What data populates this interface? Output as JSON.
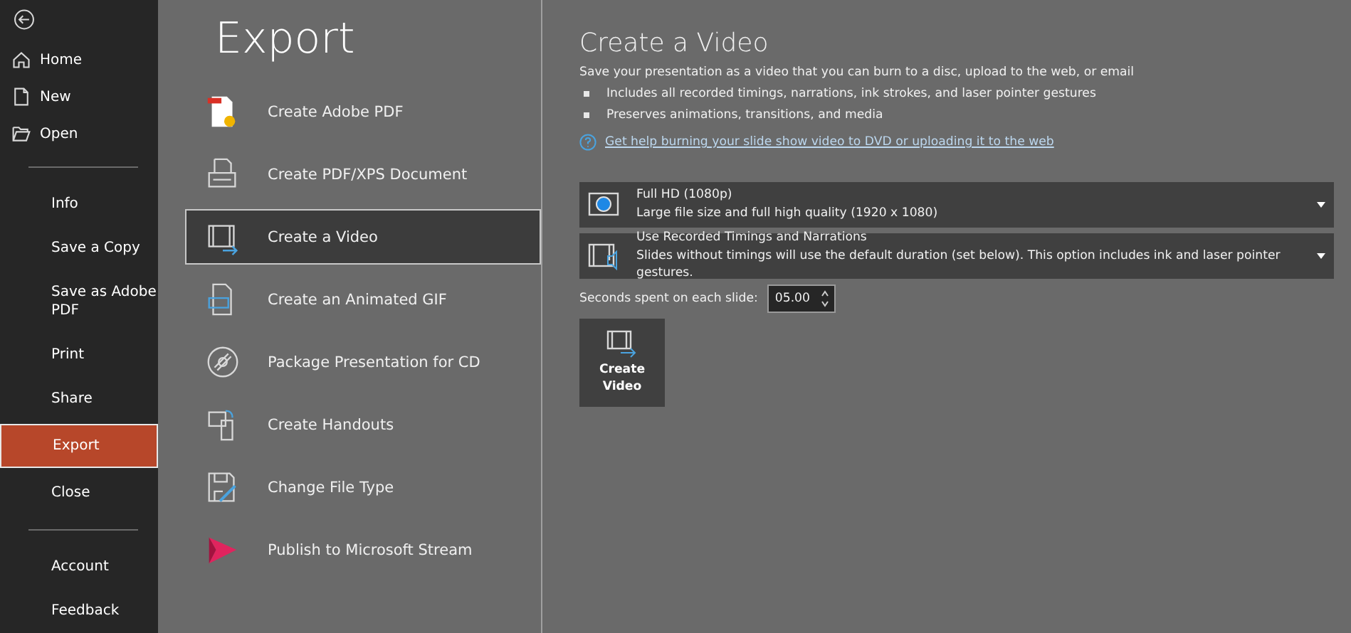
{
  "sidebar": {
    "top": [
      {
        "label": "Home"
      },
      {
        "label": "New"
      },
      {
        "label": "Open"
      }
    ],
    "middle": [
      {
        "label": "Info",
        "selected": false
      },
      {
        "label": "Save a Copy",
        "selected": false
      },
      {
        "label": "Save as Adobe PDF",
        "selected": false
      },
      {
        "label": "Print",
        "selected": false
      },
      {
        "label": "Share",
        "selected": false
      },
      {
        "label": "Export",
        "selected": true
      },
      {
        "label": "Close",
        "selected": false
      }
    ],
    "bottom": [
      {
        "label": "Account"
      },
      {
        "label": "Feedback"
      }
    ]
  },
  "page_title": "Export",
  "options": [
    {
      "label": "Create Adobe PDF",
      "selected": false
    },
    {
      "label": "Create PDF/XPS Document",
      "selected": false
    },
    {
      "label": "Create a Video",
      "selected": true
    },
    {
      "label": "Create an Animated GIF",
      "selected": false
    },
    {
      "label": "Package Presentation for CD",
      "selected": false
    },
    {
      "label": "Create Handouts",
      "selected": false
    },
    {
      "label": "Change File Type",
      "selected": false
    },
    {
      "label": "Publish to Microsoft Stream",
      "selected": false
    }
  ],
  "detail": {
    "title": "Create a Video",
    "description": "Save your presentation as a video that you can burn to a disc, upload to the web, or email",
    "bullets": [
      "Includes all recorded timings, narrations, ink strokes, and laser pointer gestures",
      "Preserves animations, transitions, and media"
    ],
    "help_link": "Get help burning your slide show video to DVD or uploading it to the web",
    "dropdowns": [
      {
        "title": "Full HD (1080p)",
        "description": "Large file size and full high quality (1920 x 1080)"
      },
      {
        "title": "Use Recorded Timings and Narrations",
        "description": "Slides without timings will use the default duration (set below). This option includes ink and laser pointer gestures."
      }
    ],
    "seconds_label": "Seconds spent on each slide:",
    "seconds_value": "05.00",
    "button": "Create Video"
  }
}
